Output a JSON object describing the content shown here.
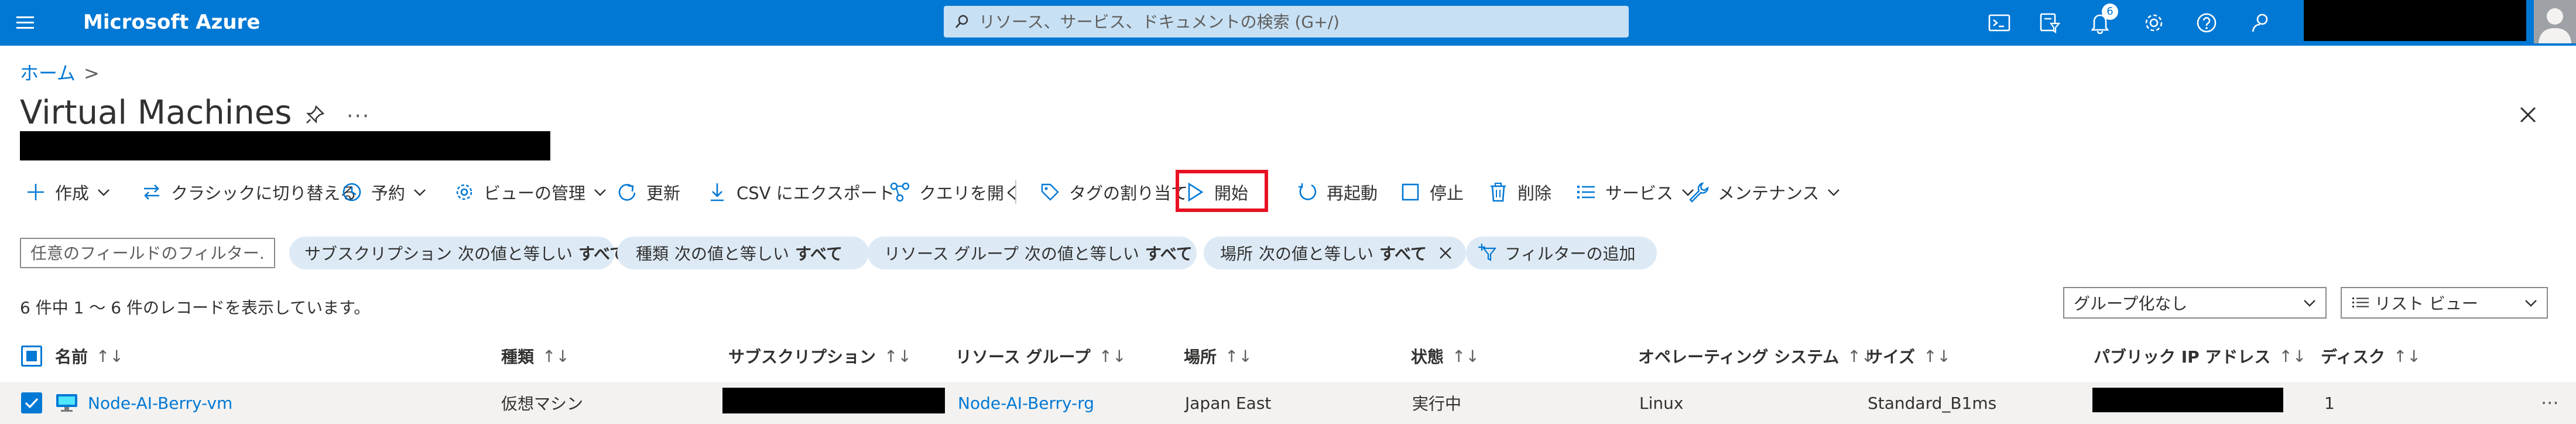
{
  "app": {
    "brand": "Microsoft Azure",
    "search_placeholder": "リソース、サービス、ドキュメントの検索 (G+/)",
    "notification_count": "6",
    "accent": "#0078d4"
  },
  "breadcrumb": {
    "home": "ホーム",
    "separator": ">"
  },
  "page": {
    "title": "Virtual Machines",
    "more": "..."
  },
  "toolbar": {
    "create": "作成",
    "switch_classic": "クラシックに切り替える",
    "reservations": "予約",
    "manage_view": "ビューの管理",
    "refresh": "更新",
    "export_csv": "CSV にエクスポート",
    "open_query": "クエリを開く",
    "assign_tags": "タグの割り当て",
    "start": "開始",
    "restart": "再起動",
    "stop": "停止",
    "delete": "削除",
    "services": "サービス",
    "maintenance": "メンテナンス"
  },
  "filters": {
    "placeholder": "任意のフィールドのフィルター...",
    "pills": [
      {
        "field": "サブスクリプション",
        "op": "次の値と等しい",
        "value": "すべて"
      },
      {
        "field": "種類",
        "op": "次の値と等しい",
        "value": "すべて"
      },
      {
        "field": "リソース グループ",
        "op": "次の値と等しい",
        "value": "すべて"
      },
      {
        "field": "場所",
        "op": "次の値と等しい",
        "value": "すべて"
      }
    ],
    "add_filter": "フィルターの追加"
  },
  "records_text": "6 件中 1 ～ 6 件のレコードを表示しています。",
  "grouping": {
    "selected": "グループ化なし"
  },
  "view_mode": {
    "selected": "リスト ビュー"
  },
  "table": {
    "sort_symbol": "↑↓",
    "columns": [
      "名前",
      "種類",
      "サブスクリプション",
      "リソース グループ",
      "場所",
      "状態",
      "オペレーティング システム",
      "サイズ",
      "パブリック IP アドレス",
      "ディスク"
    ],
    "rows": [
      {
        "name": "Node-AI-Berry-vm",
        "type": "仮想マシン",
        "subscription": "",
        "resource_group": "Node-AI-Berry-rg",
        "location": "Japan East",
        "status": "実行中",
        "os": "Linux",
        "size": "Standard_B1ms",
        "public_ip": "",
        "disks": "1",
        "actions": "···"
      }
    ]
  }
}
